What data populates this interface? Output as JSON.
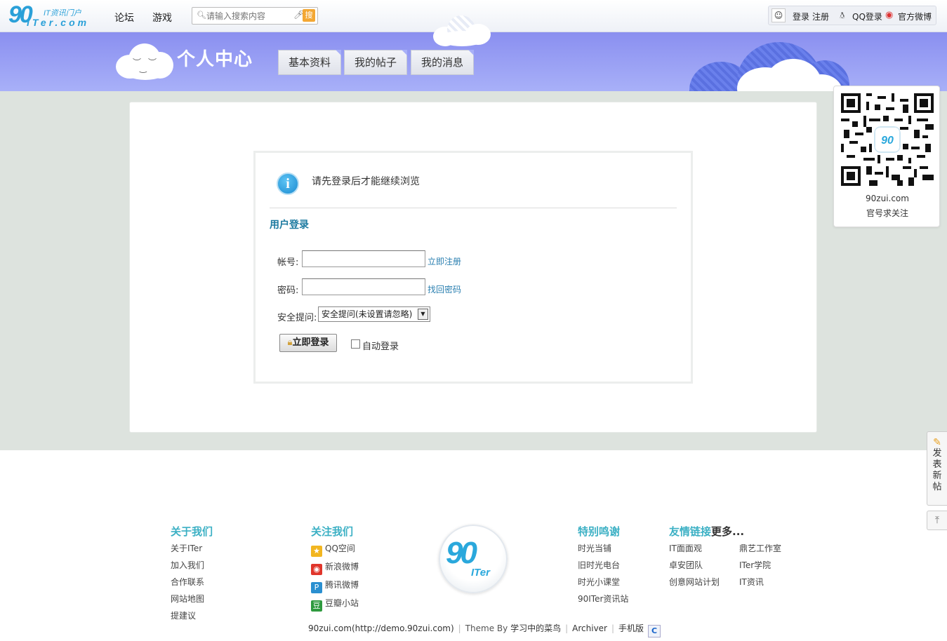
{
  "header": {
    "logo": {
      "main": "90",
      "tagline": "IT资讯门户",
      "domain": ".com",
      "sub": "ITer"
    },
    "nav": [
      {
        "label": "论坛"
      },
      {
        "label": "游戏"
      }
    ],
    "search": {
      "placeholder": "请输入搜索内容",
      "button_label": "搜"
    },
    "user": {
      "login": "登录",
      "register": "注册",
      "qq_login": "QQ登录",
      "weibo": "官方微博"
    }
  },
  "banner": {
    "title": "个人中心",
    "tabs": [
      {
        "label": "基本资料"
      },
      {
        "label": "我的帖子"
      },
      {
        "label": "我的消息"
      }
    ]
  },
  "login": {
    "message": "请先登录后才能继续浏览",
    "title": "用户登录",
    "account_label": "帐号:",
    "register_link": "立即注册",
    "password_label": "密码:",
    "forgot_link": "找回密码",
    "question_label": "安全提问:",
    "question_selected": "安全提问(未设置请忽略)",
    "submit_label": "立即登录",
    "auto_login_label": "自动登录"
  },
  "qr": {
    "site": "90zui.com",
    "caption": "官号求关注"
  },
  "side": {
    "post_label": [
      "发",
      "表",
      "新",
      "帖"
    ]
  },
  "footer": {
    "about": {
      "title": "关于我们",
      "links": [
        "关于ITer",
        "加入我们",
        "合作联系",
        "网站地图",
        "提建议"
      ]
    },
    "follow": {
      "title": "关注我们",
      "links": [
        {
          "label": "QQ空间",
          "icon": "qzone-icon",
          "color": "#f2b620"
        },
        {
          "label": "新浪微博",
          "icon": "weibo-icon",
          "color": "#e0352b"
        },
        {
          "label": "腾讯微博",
          "icon": "tencent-weibo-icon",
          "color": "#2a8fd0"
        },
        {
          "label": "豆瓣小站",
          "icon": "douban-icon",
          "color": "#2f9a3f"
        }
      ]
    },
    "thanks": {
      "title": "特别鸣谢",
      "links": [
        "时光当铺",
        "旧时光电台",
        "时光小课堂",
        "90ITer资讯站"
      ]
    },
    "friends": {
      "title": "友情链接",
      "more": "更多...",
      "links": [
        "IT面面观",
        "鼎艺工作室",
        "卓安团队",
        "ITer学院",
        "创意网站计划",
        "IT资讯"
      ]
    },
    "bottom": {
      "site": "90zui.com(http://demo.90zui.com)",
      "theme_by": "Theme By",
      "author": "学习中的菜鸟",
      "archiver": "Archiver",
      "mobile": "手机版",
      "badge": "C"
    }
  }
}
